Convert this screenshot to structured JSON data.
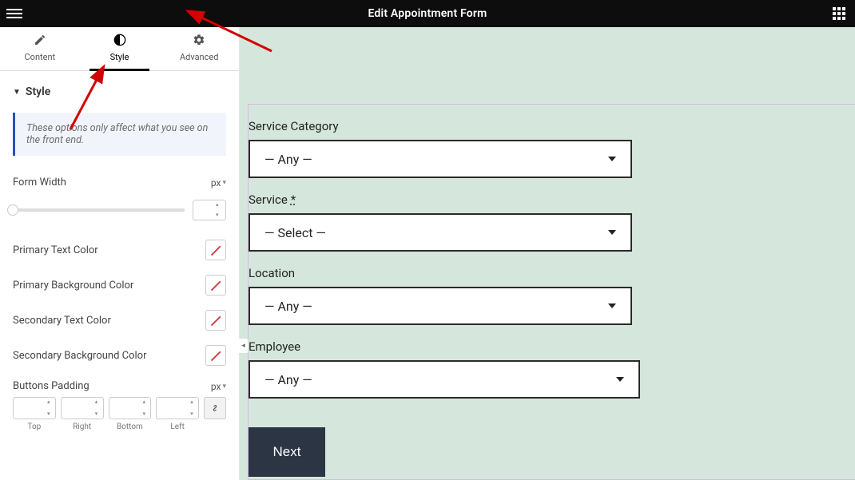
{
  "header": {
    "title": "Edit Appointment Form"
  },
  "tabs": {
    "content": "Content",
    "style": "Style",
    "advanced": "Advanced",
    "active": "style"
  },
  "section": {
    "title": "Style"
  },
  "info": "These options only affect what you see on the front end.",
  "controls": {
    "form_width": {
      "label": "Form Width",
      "unit": "px",
      "value": ""
    },
    "primary_text": "Primary Text Color",
    "primary_bg": "Primary Background Color",
    "secondary_text": "Secondary Text Color",
    "secondary_bg": "Secondary Background Color",
    "buttons_padding": {
      "label": "Buttons Padding",
      "unit": "px"
    },
    "sides": {
      "top": "Top",
      "right": "Right",
      "bottom": "Bottom",
      "left": "Left"
    }
  },
  "preview": {
    "fields": {
      "category": {
        "label": "Service Category",
        "value": "— Any —"
      },
      "service": {
        "label": "Service",
        "required": "*",
        "value": "— Select —"
      },
      "location": {
        "label": "Location",
        "value": "— Any —"
      },
      "employee": {
        "label": "Employee",
        "value": "— Any —"
      }
    },
    "next": "Next"
  }
}
